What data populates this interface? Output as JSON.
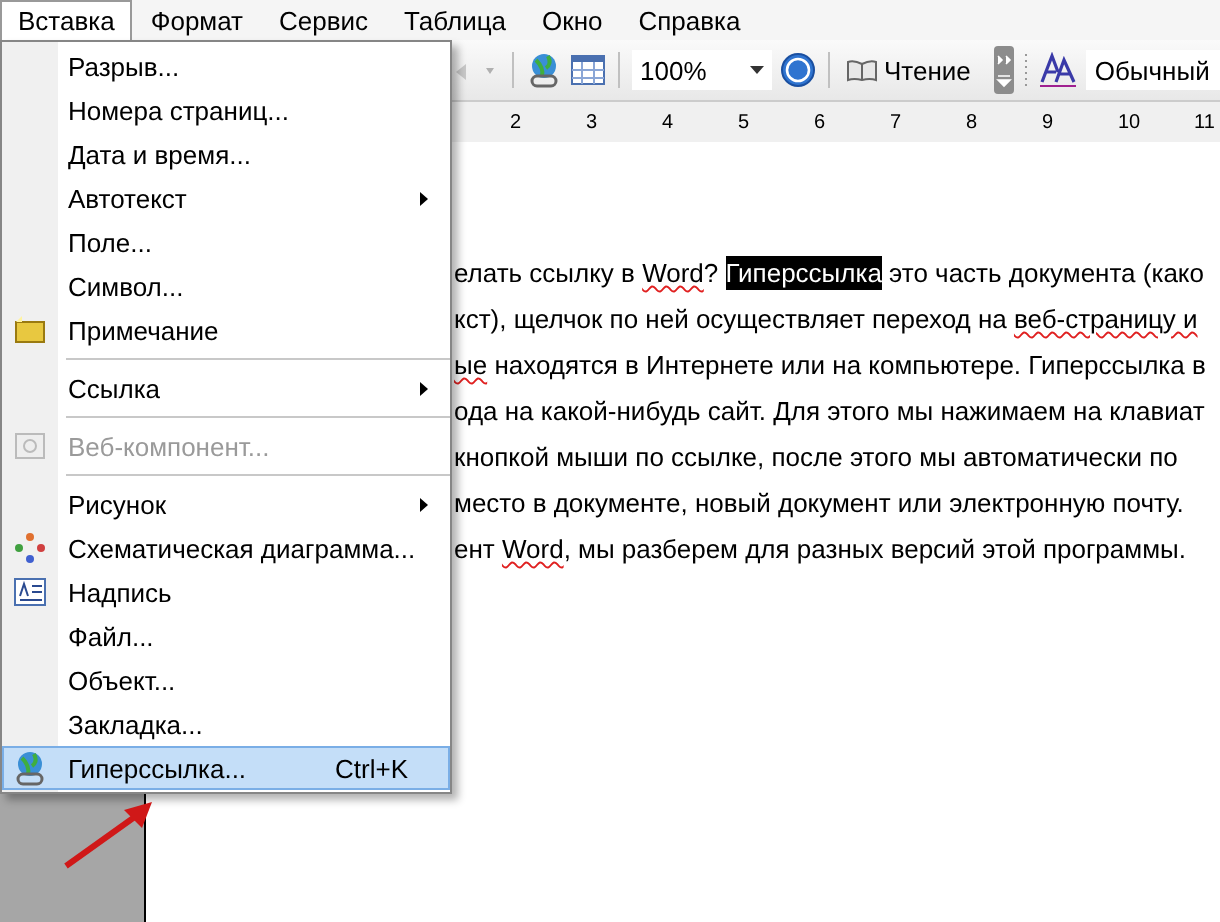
{
  "menubar": [
    {
      "label": "Вставка",
      "selected": true
    },
    {
      "label": "Формат",
      "selected": false
    },
    {
      "label": "Сервис",
      "selected": false
    },
    {
      "label": "Таблица",
      "selected": false
    },
    {
      "label": "Окно",
      "selected": false
    },
    {
      "label": "Справка",
      "selected": false
    }
  ],
  "toolbar": {
    "zoom": "100%",
    "reading_button": "Чтение",
    "style": "Обычный"
  },
  "ruler": [
    "2",
    "3",
    "4",
    "5",
    "6",
    "7",
    "8",
    "9",
    "10",
    "11"
  ],
  "document": {
    "lines": [
      [
        {
          "text": "елать ссылку в ",
          "kind": "plain"
        },
        {
          "text": "Word",
          "kind": "misspelled"
        },
        {
          "text": "? ",
          "kind": "plain"
        },
        {
          "text": "Гиперссылка",
          "kind": "selected"
        },
        {
          "text": " это часть документа (како",
          "kind": "plain"
        }
      ],
      [
        {
          "text": "кст), щелчок по ней осуществляет переход на ",
          "kind": "plain"
        },
        {
          "text": "веб-страницу и",
          "kind": "misspelled"
        }
      ],
      [
        {
          "text": "ые",
          "kind": "misspelled"
        },
        {
          "text": " находятся в Интернете или на компьютере. Гиперссылка в",
          "kind": "plain"
        }
      ],
      [
        {
          "text": "ода на какой-нибудь сайт. Для этого мы нажимаем на клавиат",
          "kind": "plain"
        }
      ],
      [
        {
          "text": " кнопкой мыши по ссылке, после этого мы автоматически по",
          "kind": "plain"
        }
      ],
      [
        {
          "text": "место в документе, новый документ или электронную почту.",
          "kind": "plain"
        }
      ],
      [
        {
          "text": "ент ",
          "kind": "plain"
        },
        {
          "text": "Word",
          "kind": "misspelled"
        },
        {
          "text": ", мы разберем для разных версий этой программы.",
          "kind": "plain"
        }
      ]
    ]
  },
  "menu": [
    {
      "kind": "item",
      "label": "Разрыв...",
      "submenu": false,
      "disabled": false,
      "selected": false
    },
    {
      "kind": "item",
      "label": "Номера страниц...",
      "submenu": false,
      "disabled": false,
      "selected": false
    },
    {
      "kind": "item",
      "label": "Дата и время...",
      "submenu": false,
      "disabled": false,
      "selected": false
    },
    {
      "kind": "item",
      "label": "Автотекст",
      "submenu": true,
      "disabled": false,
      "selected": false
    },
    {
      "kind": "item",
      "label": "Поле...",
      "submenu": false,
      "disabled": false,
      "selected": false
    },
    {
      "kind": "item",
      "label": "Символ...",
      "submenu": false,
      "disabled": false,
      "selected": false
    },
    {
      "kind": "item",
      "label": "Примечание",
      "submenu": false,
      "disabled": false,
      "selected": false
    },
    {
      "kind": "separator"
    },
    {
      "kind": "item",
      "label": "Ссылка",
      "submenu": true,
      "disabled": false,
      "selected": false
    },
    {
      "kind": "separator"
    },
    {
      "kind": "item",
      "label": "Веб-компонент...",
      "submenu": false,
      "disabled": true,
      "selected": false
    },
    {
      "kind": "separator"
    },
    {
      "kind": "item",
      "label": "Рисунок",
      "submenu": true,
      "disabled": false,
      "selected": false
    },
    {
      "kind": "item",
      "label": "Схематическая диаграмма...",
      "submenu": false,
      "disabled": false,
      "selected": false
    },
    {
      "kind": "item",
      "label": "Надпись",
      "submenu": false,
      "disabled": false,
      "selected": false
    },
    {
      "kind": "item",
      "label": "Файл...",
      "submenu": false,
      "disabled": false,
      "selected": false
    },
    {
      "kind": "item",
      "label": "Объект...",
      "submenu": false,
      "disabled": false,
      "selected": false
    },
    {
      "kind": "item",
      "label": "Закладка...",
      "submenu": false,
      "disabled": false,
      "selected": false
    },
    {
      "kind": "item",
      "label": "Гиперссылка...",
      "submenu": false,
      "disabled": false,
      "selected": true,
      "shortcut": "Ctrl+K"
    }
  ]
}
